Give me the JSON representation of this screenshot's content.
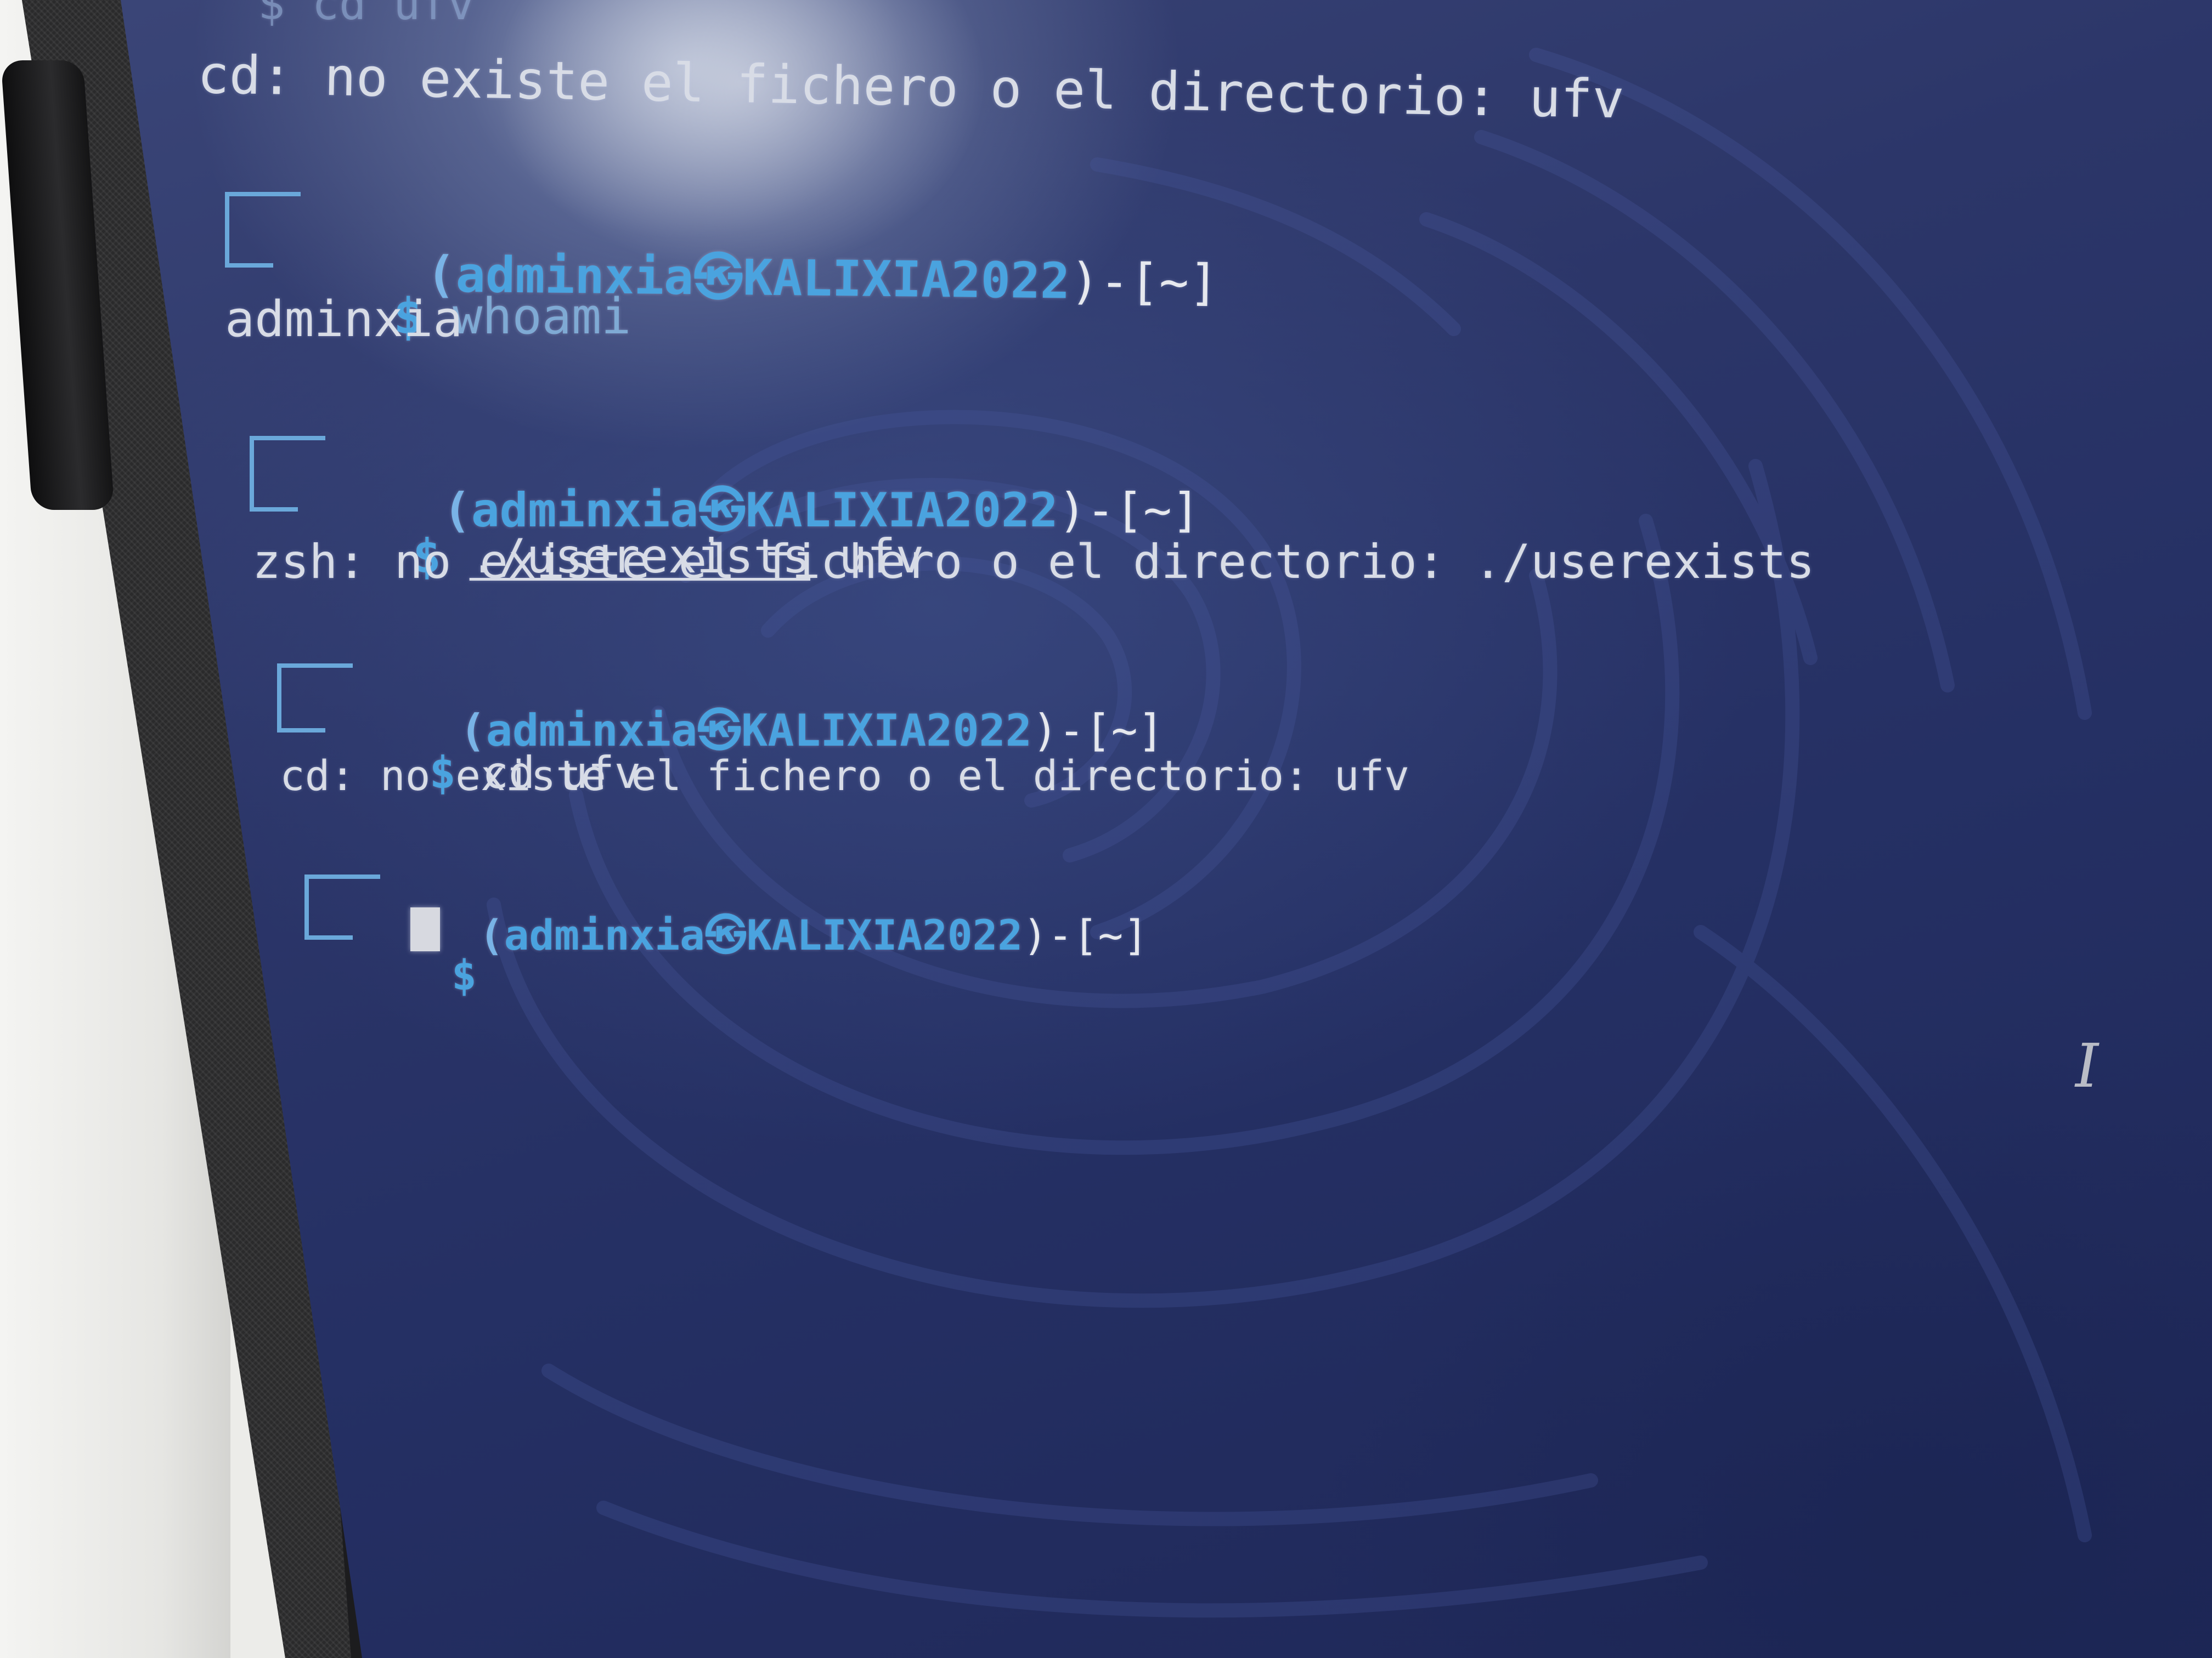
{
  "terminal": {
    "top_partial_command": "$ cd ufv",
    "lines": [
      {
        "kind": "output",
        "text": "cd: no existe el fichero o el directorio: ufv"
      },
      {
        "kind": "prompt",
        "user": "adminxia",
        "separator": "㉿",
        "host": "KALIXIA2022",
        "path": "~",
        "command": "whoami"
      },
      {
        "kind": "output",
        "text": "adminxia"
      },
      {
        "kind": "prompt",
        "user": "adminxia",
        "separator": "㉿",
        "host": "KALIXIA2022",
        "path": "~",
        "command_path": "./userexists",
        "command_arg": " ufv"
      },
      {
        "kind": "output",
        "text": "zsh: no existe el fichero o el directorio: ./userexists"
      },
      {
        "kind": "prompt",
        "user": "adminxia",
        "separator": "㉿",
        "host": "KALIXIA2022",
        "path": "~",
        "command": "cd ufv"
      },
      {
        "kind": "output",
        "text": "cd: no existe el fichero o el directorio: ufv"
      },
      {
        "kind": "prompt",
        "user": "adminxia",
        "separator": "㉿",
        "host": "KALIXIA2022",
        "path": "~",
        "command": ""
      }
    ],
    "prompt_symbol": "$",
    "path_prefix": ")-[",
    "path_suffix": "]",
    "open_paren": "(",
    "colors": {
      "prompt_blue": "#4aa3df",
      "text": "#d8dce6",
      "background": "#2c3669"
    }
  },
  "icons": {
    "mouse_cursor": "i-beam-icon",
    "text_cursor": "block-cursor-icon"
  }
}
